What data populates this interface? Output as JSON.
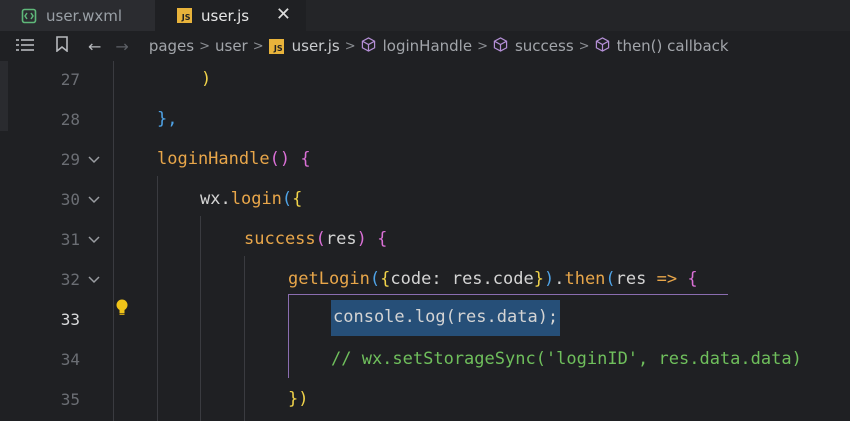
{
  "tabs": [
    {
      "label": "user.wxml",
      "icon": "wxml-file-icon"
    },
    {
      "label": "user.js",
      "icon": "js-file-icon",
      "badge": "JS"
    }
  ],
  "breadcrumb": {
    "items": [
      "pages",
      "user",
      "user.js",
      "loginHandle",
      "success",
      "then() callback"
    ],
    "file_badge": "JS"
  },
  "editor": {
    "active_line": "33",
    "line_numbers": [
      "27",
      "28",
      "29",
      "30",
      "31",
      "32",
      "33",
      "34",
      "35"
    ],
    "lines": {
      "l27": [
        ")"
      ],
      "l28": [
        "},"
      ],
      "l29": [
        "loginHandle",
        "(",
        ")",
        " {"
      ],
      "l30": [
        "wx",
        ".",
        "login",
        "(",
        "{"
      ],
      "l31": [
        "success",
        "(",
        "res",
        ")",
        " {"
      ],
      "l32": [
        "getLogin",
        "(",
        "{",
        "code",
        ": ",
        "res.code",
        "}",
        ")",
        ".",
        "then",
        "(",
        "res",
        " => ",
        "{"
      ],
      "l33": [
        "console.log(res.data);"
      ],
      "l34": [
        "// wx.setStorageSync('loginID', res.data.data)"
      ],
      "l35": [
        "})"
      ]
    }
  },
  "colors": {
    "function": "#e8a64a",
    "bracket_yellow": "#f1d34a",
    "bracket_purple": "#da70d6",
    "bracket_blue": "#4fa3e6",
    "comment": "#6fbf5c",
    "selection": "#264f78"
  }
}
